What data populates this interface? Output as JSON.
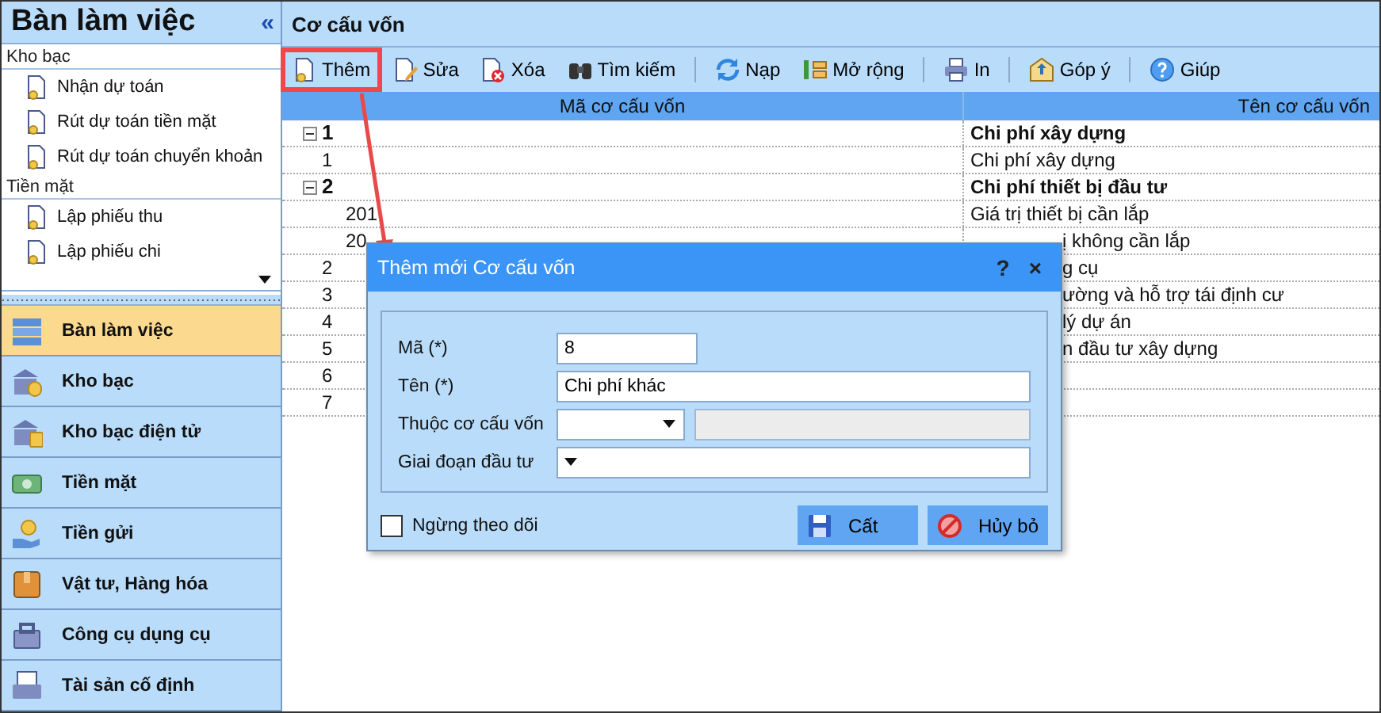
{
  "sidebar": {
    "title": "Bàn làm việc",
    "collapse": "«",
    "groups": [
      {
        "label": "Kho bạc",
        "items": [
          "Nhận dự toán",
          "Rút dự toán tiền mặt",
          "Rút dự toán chuyển khoản"
        ]
      },
      {
        "label": "Tiền mặt",
        "items": [
          "Lập phiếu thu",
          "Lập phiếu chi"
        ]
      }
    ],
    "nav": [
      {
        "label": "Bàn làm việc",
        "selected": true
      },
      {
        "label": "Kho bạc",
        "selected": false
      },
      {
        "label": "Kho bạc điện tử",
        "selected": false
      },
      {
        "label": "Tiền mặt",
        "selected": false
      },
      {
        "label": "Tiền gửi",
        "selected": false
      },
      {
        "label": "Vật tư, Hàng hóa",
        "selected": false
      },
      {
        "label": "Công cụ dụng cụ",
        "selected": false
      },
      {
        "label": "Tài sản cố định",
        "selected": false
      }
    ]
  },
  "title": "Cơ cấu vốn",
  "toolbar": {
    "groups": [
      [
        {
          "label": "Thêm",
          "highlighted": true
        },
        {
          "label": "Sửa",
          "highlighted": false
        },
        {
          "label": "Xóa",
          "highlighted": false
        },
        {
          "label": "Tìm kiếm",
          "highlighted": false
        }
      ],
      [
        {
          "label": "Nạp",
          "highlighted": false
        },
        {
          "label": "Mở rộng",
          "highlighted": false
        }
      ],
      [
        {
          "label": "In",
          "highlighted": false
        }
      ],
      [
        {
          "label": "Góp ý",
          "highlighted": false
        }
      ],
      [
        {
          "label": "Giúp",
          "highlighted": false
        }
      ]
    ]
  },
  "table": {
    "columns": [
      "Mã cơ cấu vốn",
      "Tên cơ cấu vốn"
    ],
    "rows": [
      {
        "kind": "group",
        "expanded": true,
        "code": "1",
        "name": "Chi phí xây dựng"
      },
      {
        "kind": "item",
        "code": "1",
        "name": "Chi phí xây dựng"
      },
      {
        "kind": "group",
        "expanded": true,
        "code": "2",
        "name": "Chi phí thiết bị đầu tư"
      },
      {
        "kind": "item",
        "code": "201",
        "name": "Giá trị thiết bị cần lắp"
      },
      {
        "kind": "covered",
        "code": "20",
        "name": "ị không cần lắp"
      },
      {
        "kind": "covered",
        "code": "2",
        "name": "g cụ"
      },
      {
        "kind": "covered",
        "code": "3",
        "name": "ường và hỗ trợ tái định cư"
      },
      {
        "kind": "covered",
        "code": "4",
        "name": "lý dự án"
      },
      {
        "kind": "covered",
        "code": "5",
        "name": "n đầu tư xây dựng"
      },
      {
        "kind": "covered",
        "code": "6"
      },
      {
        "kind": "covered",
        "code": "7"
      }
    ]
  },
  "dialog": {
    "title": "Thêm mới Cơ cấu vốn",
    "help": "?",
    "close": "×",
    "fields": [
      {
        "kind": "short",
        "label": "Mã (*)",
        "value": "8"
      },
      {
        "kind": "text",
        "label": "Tên (*)",
        "value": "Chi phí khác"
      },
      {
        "kind": "combo_display",
        "label": "Thuộc cơ cấu vốn"
      },
      {
        "kind": "combo",
        "label": "Giai đoạn đầu tư"
      }
    ],
    "checkbox": {
      "label": "Ngừng theo dõi",
      "checked": false
    },
    "buttons": [
      "Cất",
      "Hủy bỏ"
    ]
  }
}
